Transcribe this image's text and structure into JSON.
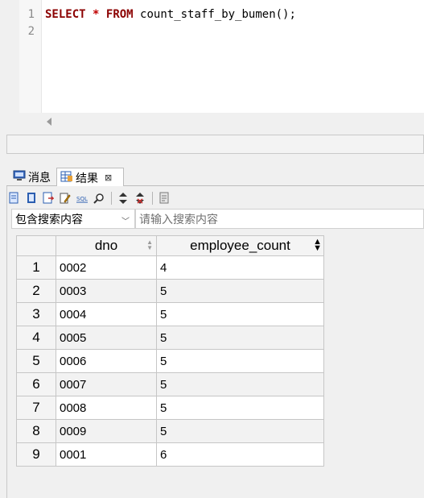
{
  "editor": {
    "lines": [
      {
        "no": "1",
        "kw1": "SELECT",
        "star": "*",
        "kw2": "FROM",
        "rest": "count_staff_by_bumen();"
      },
      {
        "no": "2"
      }
    ]
  },
  "tabs": {
    "messages": "消息",
    "results": "结果"
  },
  "search": {
    "mode_selected": "包含搜索内容",
    "placeholder": "请输入搜索内容"
  },
  "table": {
    "columns": [
      "dno",
      "employee_count"
    ],
    "rows": [
      {
        "n": "1",
        "dno": "0002",
        "employee_count": "4"
      },
      {
        "n": "2",
        "dno": "0003",
        "employee_count": "5"
      },
      {
        "n": "3",
        "dno": "0004",
        "employee_count": "5"
      },
      {
        "n": "4",
        "dno": "0005",
        "employee_count": "5"
      },
      {
        "n": "5",
        "dno": "0006",
        "employee_count": "5"
      },
      {
        "n": "6",
        "dno": "0007",
        "employee_count": "5"
      },
      {
        "n": "7",
        "dno": "0008",
        "employee_count": "5"
      },
      {
        "n": "8",
        "dno": "0009",
        "employee_count": "5"
      },
      {
        "n": "9",
        "dno": "0001",
        "employee_count": "6"
      }
    ]
  },
  "colors": {
    "keyword": "#8b0000",
    "accent_blue": "#2a5db0"
  }
}
